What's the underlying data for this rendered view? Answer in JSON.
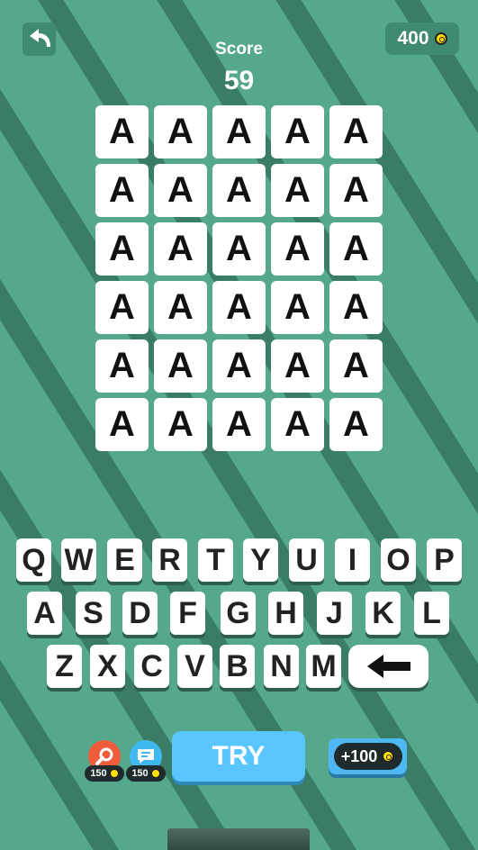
{
  "header": {
    "back_icon": "undo-arrow-icon",
    "coins": "400",
    "coin_icon": "coin-icon",
    "score_label": "Score",
    "score_value": "59"
  },
  "board": {
    "rows": [
      [
        "A",
        "A",
        "A",
        "A",
        "A"
      ],
      [
        "A",
        "A",
        "A",
        "A",
        "A"
      ],
      [
        "A",
        "A",
        "A",
        "A",
        "A"
      ],
      [
        "A",
        "A",
        "A",
        "A",
        "A"
      ],
      [
        "A",
        "A",
        "A",
        "A",
        "A"
      ],
      [
        "A",
        "A",
        "A",
        "A",
        "A"
      ]
    ]
  },
  "keyboard": {
    "rows": [
      [
        "Q",
        "W",
        "E",
        "R",
        "T",
        "Y",
        "U",
        "I",
        "O",
        "P"
      ],
      [
        "A",
        "S",
        "D",
        "F",
        "G",
        "H",
        "J",
        "K",
        "L"
      ],
      [
        "Z",
        "X",
        "C",
        "V",
        "B",
        "N",
        "M"
      ]
    ],
    "backspace_icon": "backspace-arrow-icon"
  },
  "actions": {
    "hint_icon": "magnifier-icon",
    "hint_cost": "150",
    "chat_icon": "chat-bubble-icon",
    "chat_cost": "150",
    "try_label": "TRY",
    "bonus_label": "+100"
  },
  "colors": {
    "background": "#55a88c",
    "stripe": "#3a7d67",
    "try_button": "#59c6ff",
    "hint_button": "#ef5b3b",
    "chat_button": "#3fb8ef",
    "coin": "#ffe100"
  }
}
